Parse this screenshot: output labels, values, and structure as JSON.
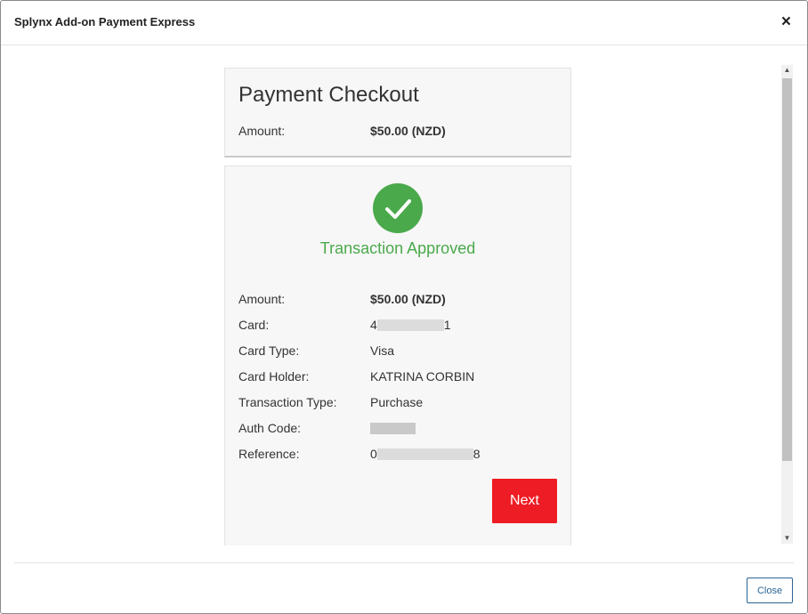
{
  "modal": {
    "title": "Splynx Add-on Payment Express",
    "close_icon": "×",
    "close_button_label": "Close"
  },
  "checkout": {
    "title": "Payment Checkout",
    "amount_label": "Amount:",
    "amount_value": "$50.00 (NZD)"
  },
  "result": {
    "status_icon": "check-circle",
    "status_text": "Transaction Approved",
    "status_color": "#4aa94b",
    "details": [
      {
        "label": "Amount:",
        "value": "$50.00 (NZD)"
      },
      {
        "label": "Card:",
        "prefix": "4",
        "suffix": "1"
      },
      {
        "label": "Card Type:",
        "value": "Visa"
      },
      {
        "label": "Card Holder:",
        "value": "KATRINA CORBIN"
      },
      {
        "label": "Transaction Type:",
        "value": "Purchase"
      },
      {
        "label": "Auth Code:",
        "value": ""
      },
      {
        "label": "Reference:",
        "prefix": "0",
        "suffix": "8"
      }
    ],
    "next_button_label": "Next",
    "next_button_color": "#ee1c24"
  }
}
